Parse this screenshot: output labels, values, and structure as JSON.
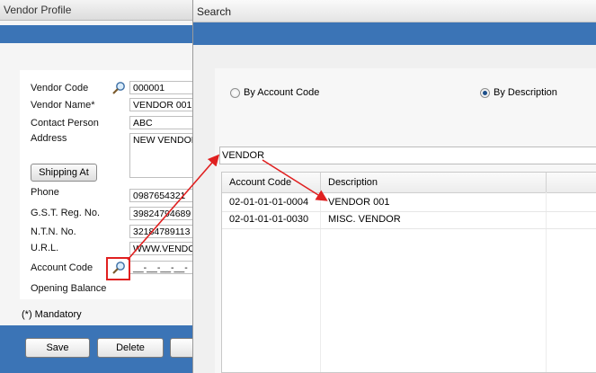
{
  "vendor_profile": {
    "title": "Vendor Profile",
    "labels": {
      "vendor_code": "Vendor Code",
      "vendor_name": "Vendor Name*",
      "contact_person": "Contact Person",
      "address": "Address",
      "phone": "Phone",
      "gst": "G.S.T. Reg. No.",
      "ntn": "N.T.N. No.",
      "url": "U.R.L.",
      "account_code": "Account Code",
      "opening_balance": "Opening Balance"
    },
    "values": {
      "vendor_code": "000001",
      "vendor_name": "VENDOR 001",
      "contact_person": "ABC",
      "address": "NEW VENDOR",
      "phone": "0987654321",
      "gst": "39824794689",
      "ntn": "32184789113",
      "url": "WWW.VENDOR",
      "account_code": "__-__-__-__-",
      "opening_balance": ""
    },
    "shipping_button": "Shipping At",
    "mandatory_note": "(*) Mandatory",
    "buttons": {
      "save": "Save",
      "delete": "Delete"
    }
  },
  "search": {
    "title": "Search",
    "radio_account": "By Account Code",
    "radio_description": "By Description",
    "selected": "description",
    "query": "VENDOR",
    "columns": [
      "Account Code",
      "Description"
    ],
    "rows": [
      {
        "code": "02-01-01-01-0004",
        "description": "VENDOR 001"
      },
      {
        "code": "02-01-01-01-0030",
        "description": "MISC. VENDOR"
      }
    ]
  },
  "colors": {
    "band": "#3b74b6",
    "annotation": "#e02020",
    "radio_dot": "#1c4f8a"
  },
  "icons": {
    "lookup": "magnifier-icon"
  }
}
